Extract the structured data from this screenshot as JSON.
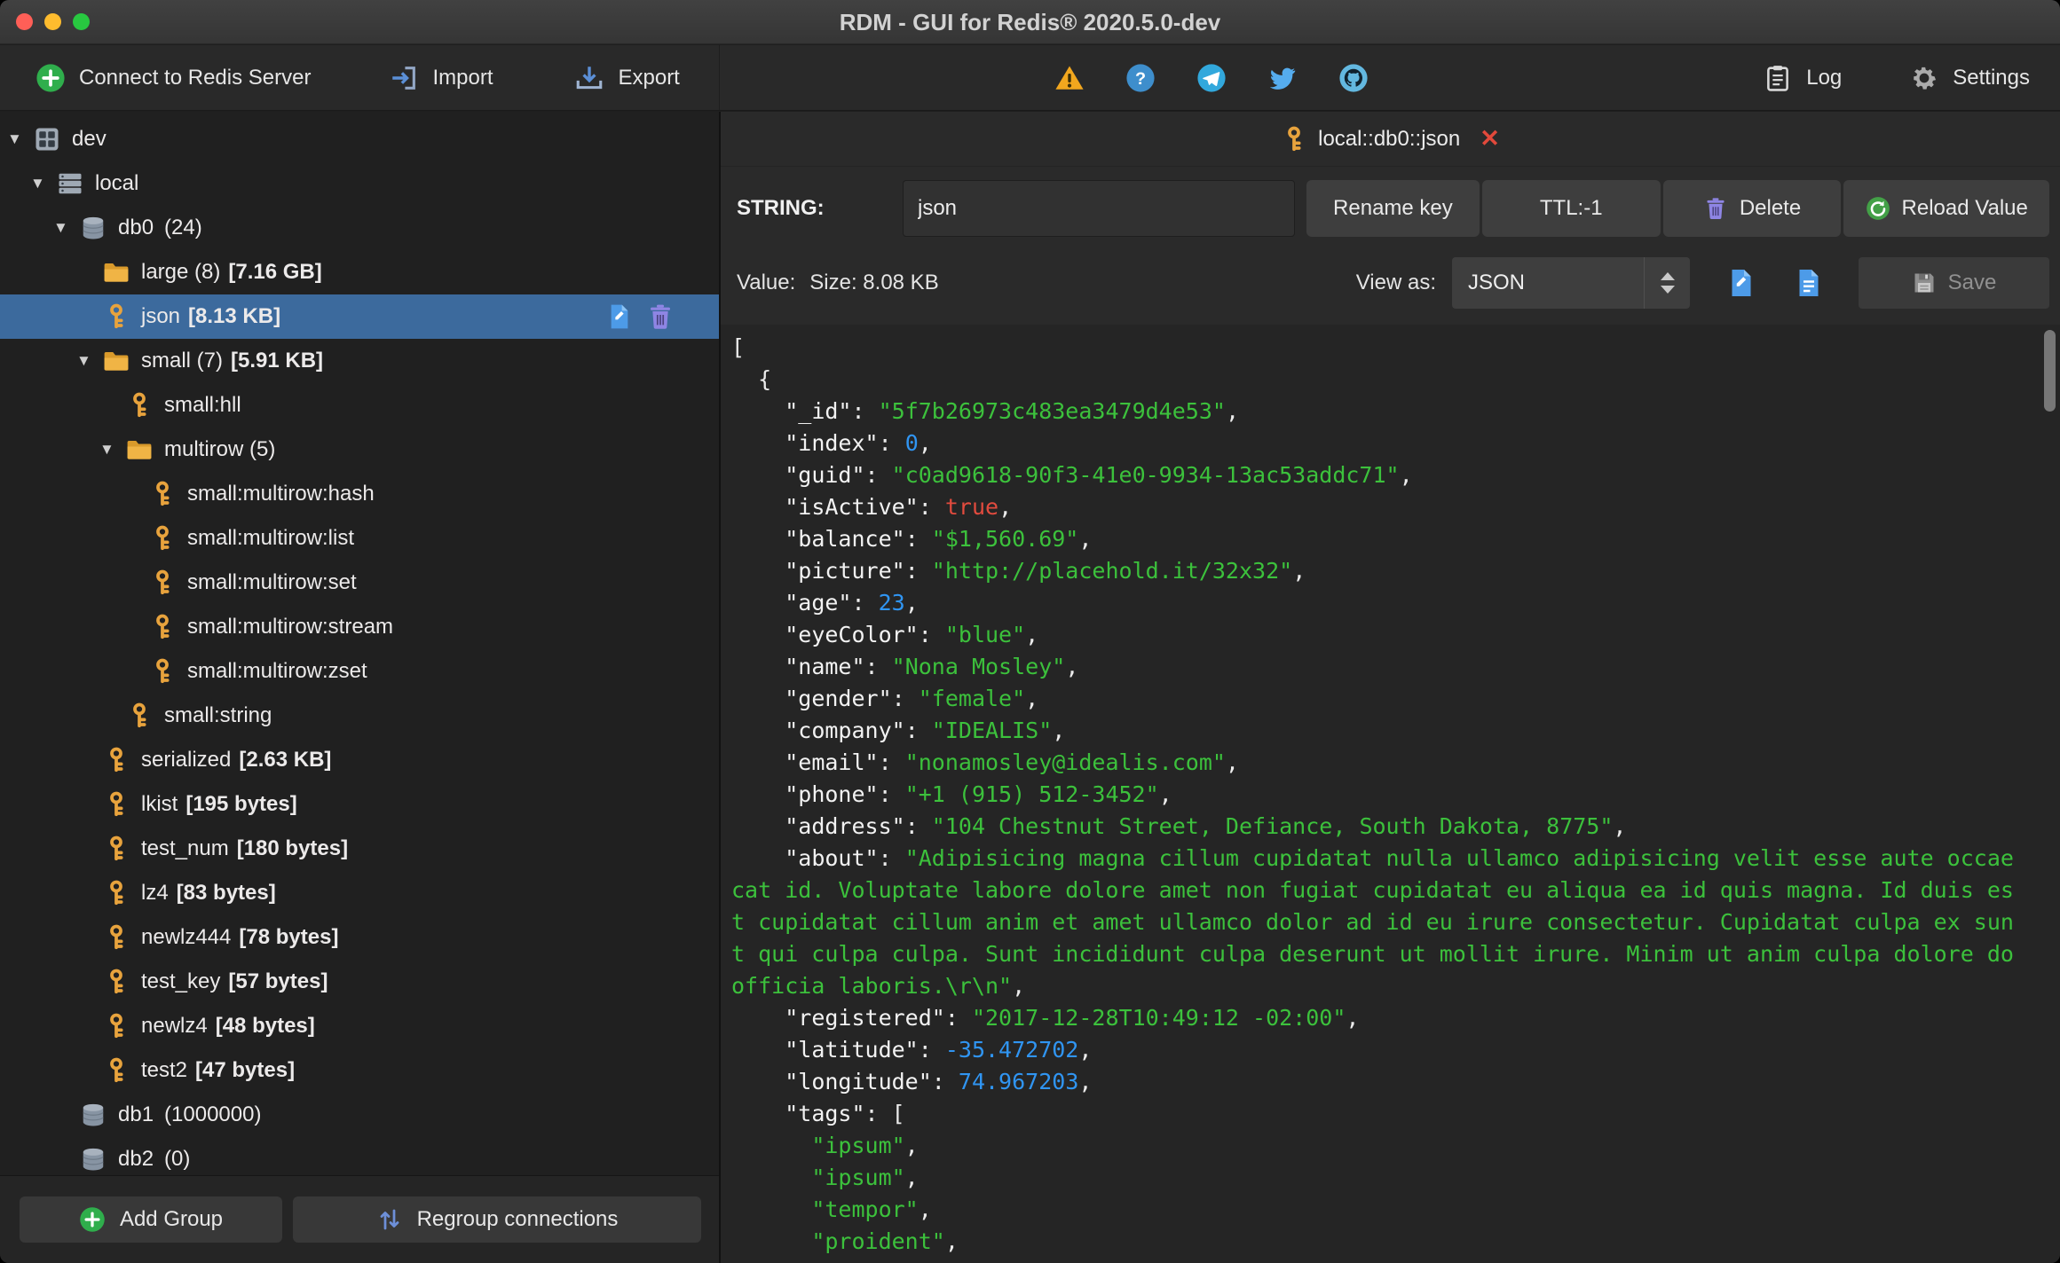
{
  "window": {
    "title": "RDM - GUI for Redis® 2020.5.0-dev"
  },
  "glyphs": {
    "disclosure_down": "▼",
    "close": "✕"
  },
  "colors": {
    "selection_blue": "#3C6A9D",
    "key_gold": "#E8A33D",
    "string_green": "#3CC13C",
    "number_blue": "#3095F2",
    "boolean_red": "#E24B3E"
  },
  "toolbar": {
    "connect_label": "Connect to Redis Server",
    "import_label": "Import",
    "export_label": "Export",
    "log_label": "Log",
    "settings_label": "Settings",
    "status_icons": [
      "warning-icon",
      "help-icon",
      "telegram-icon",
      "twitter-icon",
      "github-icon"
    ]
  },
  "sidebar": {
    "add_group_label": "Add Group",
    "regroup_label": "Regroup connections",
    "tree": [
      {
        "level": 0,
        "arrow": "down",
        "icon": "server",
        "label": "dev"
      },
      {
        "level": 1,
        "arrow": "down",
        "icon": "stack",
        "label": "local"
      },
      {
        "level": 2,
        "arrow": "down",
        "icon": "db",
        "label": "db0",
        "count": "(24)"
      },
      {
        "level": 3,
        "icon": "folder",
        "label": "large (8)",
        "size": "[7.16 GB]"
      },
      {
        "level": 3,
        "icon": "key",
        "label": "json",
        "size": "[8.13 KB]",
        "selected": true,
        "actions": true
      },
      {
        "level": 3,
        "arrow": "down",
        "icon": "folder",
        "label": "small (7)",
        "size": "[5.91 KB]"
      },
      {
        "level": 4,
        "icon": "key",
        "label": "small:hll"
      },
      {
        "level": 4,
        "arrow": "down",
        "icon": "folder",
        "label": "multirow (5)"
      },
      {
        "level": 5,
        "icon": "key",
        "label": "small:multirow:hash"
      },
      {
        "level": 5,
        "icon": "key",
        "label": "small:multirow:list"
      },
      {
        "level": 5,
        "icon": "key",
        "label": "small:multirow:set"
      },
      {
        "level": 5,
        "icon": "key",
        "label": "small:multirow:stream"
      },
      {
        "level": 5,
        "icon": "key",
        "label": "small:multirow:zset"
      },
      {
        "level": 4,
        "icon": "key",
        "label": "small:string"
      },
      {
        "level": 3,
        "icon": "key",
        "label": "serialized",
        "size": "[2.63 KB]"
      },
      {
        "level": 3,
        "icon": "key",
        "label": "lkist",
        "size": "[195 bytes]"
      },
      {
        "level": 3,
        "icon": "key",
        "label": "test_num",
        "size": "[180 bytes]"
      },
      {
        "level": 3,
        "icon": "key",
        "label": "lz4",
        "size": "[83 bytes]"
      },
      {
        "level": 3,
        "icon": "key",
        "label": "newlz444",
        "size": "[78 bytes]"
      },
      {
        "level": 3,
        "icon": "key",
        "label": "test_key",
        "size": "[57 bytes]"
      },
      {
        "level": 3,
        "icon": "key",
        "label": "newlz4",
        "size": "[48 bytes]"
      },
      {
        "level": 3,
        "icon": "key",
        "label": "test2",
        "size": "[47 bytes]"
      },
      {
        "level": 2,
        "icon": "db",
        "label": "db1",
        "count": "(1000000)"
      },
      {
        "level": 2,
        "icon": "db",
        "label": "db2",
        "count": "(0)"
      }
    ]
  },
  "main": {
    "tab": {
      "title": "local::db0::json"
    },
    "key": {
      "type_label": "STRING:",
      "name": "json",
      "rename_label": "Rename key",
      "ttl_label": "TTL:-1",
      "delete_label": "Delete",
      "reload_label": "Reload Value"
    },
    "value_bar": {
      "value_label": "Value:",
      "size_label": "Size: 8.08 KB",
      "view_as_label": "View as:",
      "view_as_selected": "JSON",
      "save_label": "Save"
    },
    "editor": {
      "lines": [
        [
          [
            "p",
            "["
          ]
        ],
        [
          [
            "p",
            "  {"
          ]
        ],
        [
          [
            "k",
            "    \"_id\""
          ],
          [
            "p",
            ": "
          ],
          [
            "s",
            "\"5f7b26973c483ea3479d4e53\""
          ],
          [
            "p",
            ","
          ]
        ],
        [
          [
            "k",
            "    \"index\""
          ],
          [
            "p",
            ": "
          ],
          [
            "n",
            "0"
          ],
          [
            "p",
            ","
          ]
        ],
        [
          [
            "k",
            "    \"guid\""
          ],
          [
            "p",
            ": "
          ],
          [
            "s",
            "\"c0ad9618-90f3-41e0-9934-13ac53addc71\""
          ],
          [
            "p",
            ","
          ]
        ],
        [
          [
            "k",
            "    \"isActive\""
          ],
          [
            "p",
            ": "
          ],
          [
            "b",
            "true"
          ],
          [
            "p",
            ","
          ]
        ],
        [
          [
            "k",
            "    \"balance\""
          ],
          [
            "p",
            ": "
          ],
          [
            "s",
            "\"$1,560.69\""
          ],
          [
            "p",
            ","
          ]
        ],
        [
          [
            "k",
            "    \"picture\""
          ],
          [
            "p",
            ": "
          ],
          [
            "s",
            "\"http://placehold.it/32x32\""
          ],
          [
            "p",
            ","
          ]
        ],
        [
          [
            "k",
            "    \"age\""
          ],
          [
            "p",
            ": "
          ],
          [
            "n",
            "23"
          ],
          [
            "p",
            ","
          ]
        ],
        [
          [
            "k",
            "    \"eyeColor\""
          ],
          [
            "p",
            ": "
          ],
          [
            "s",
            "\"blue\""
          ],
          [
            "p",
            ","
          ]
        ],
        [
          [
            "k",
            "    \"name\""
          ],
          [
            "p",
            ": "
          ],
          [
            "s",
            "\"Nona Mosley\""
          ],
          [
            "p",
            ","
          ]
        ],
        [
          [
            "k",
            "    \"gender\""
          ],
          [
            "p",
            ": "
          ],
          [
            "s",
            "\"female\""
          ],
          [
            "p",
            ","
          ]
        ],
        [
          [
            "k",
            "    \"company\""
          ],
          [
            "p",
            ": "
          ],
          [
            "s",
            "\"IDEALIS\""
          ],
          [
            "p",
            ","
          ]
        ],
        [
          [
            "k",
            "    \"email\""
          ],
          [
            "p",
            ": "
          ],
          [
            "s",
            "\"nonamosley@idealis.com\""
          ],
          [
            "p",
            ","
          ]
        ],
        [
          [
            "k",
            "    \"phone\""
          ],
          [
            "p",
            ": "
          ],
          [
            "s",
            "\"+1 (915) 512-3452\""
          ],
          [
            "p",
            ","
          ]
        ],
        [
          [
            "k",
            "    \"address\""
          ],
          [
            "p",
            ": "
          ],
          [
            "s",
            "\"104 Chestnut Street, Defiance, South Dakota, 8775\""
          ],
          [
            "p",
            ","
          ]
        ],
        [
          [
            "k",
            "    \"about\""
          ],
          [
            "p",
            ": "
          ],
          [
            "s",
            "\"Adipisicing magna cillum cupidatat nulla ullamco adipisicing velit esse aute occaecat id. Voluptate labore dolore amet non fugiat cupidatat eu aliqua ea id quis magna. Id duis est cupidatat cillum anim et amet ullamco dolor ad id eu irure consectetur. Cupidatat culpa ex sunt qui culpa culpa. Sunt incididunt culpa deserunt ut mollit irure. Minim ut anim culpa dolore do officia laboris.\\r\\n\""
          ],
          [
            "p",
            ","
          ]
        ],
        [
          [
            "k",
            "    \"registered\""
          ],
          [
            "p",
            ": "
          ],
          [
            "s",
            "\"2017-12-28T10:49:12 -02:00\""
          ],
          [
            "p",
            ","
          ]
        ],
        [
          [
            "k",
            "    \"latitude\""
          ],
          [
            "p",
            ": "
          ],
          [
            "n",
            "-35.472702"
          ],
          [
            "p",
            ","
          ]
        ],
        [
          [
            "k",
            "    \"longitude\""
          ],
          [
            "p",
            ": "
          ],
          [
            "n",
            "74.967203"
          ],
          [
            "p",
            ","
          ]
        ],
        [
          [
            "k",
            "    \"tags\""
          ],
          [
            "p",
            ": "
          ],
          [
            "p",
            "["
          ]
        ],
        [
          [
            "s",
            "      \"ipsum\""
          ],
          [
            "p",
            ","
          ]
        ],
        [
          [
            "s",
            "      \"ipsum\""
          ],
          [
            "p",
            ","
          ]
        ],
        [
          [
            "s",
            "      \"tempor\""
          ],
          [
            "p",
            ","
          ]
        ],
        [
          [
            "s",
            "      \"proident\""
          ],
          [
            "p",
            ","
          ]
        ]
      ]
    }
  }
}
